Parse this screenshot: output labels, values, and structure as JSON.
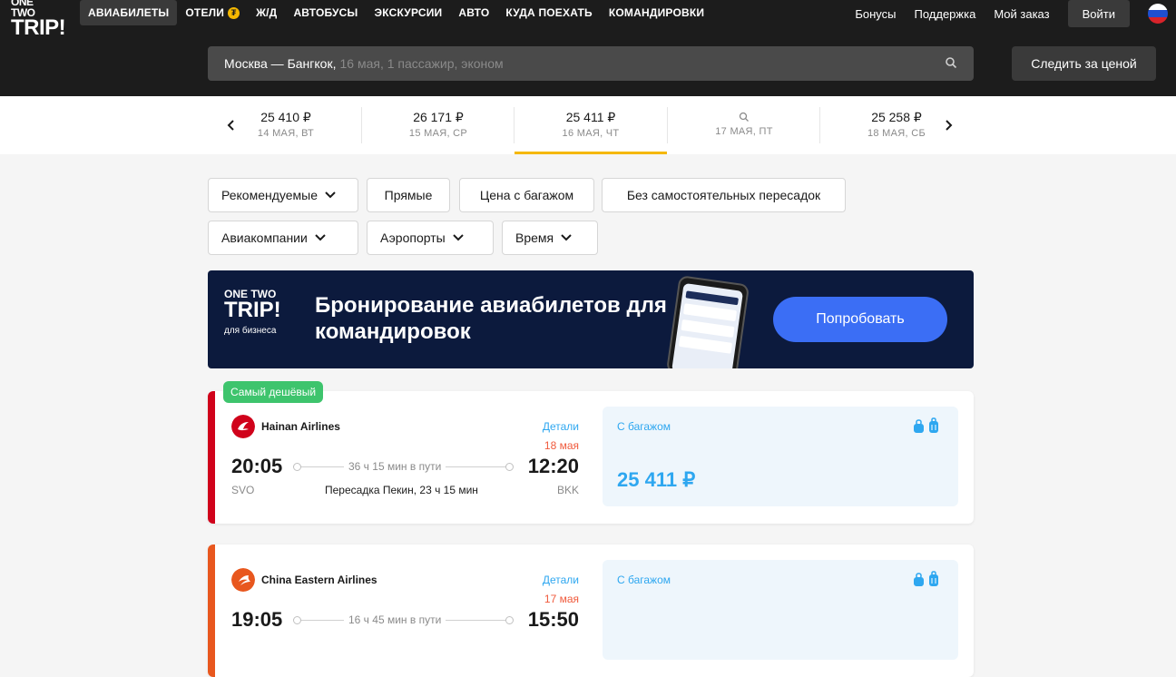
{
  "header": {
    "logo_line1": "ONE TWO",
    "logo_line2": "TRIP!",
    "nav": [
      {
        "label": "АВИАБИЛЕТЫ"
      },
      {
        "label": "ОТЕЛИ"
      },
      {
        "label": "Ж/Д"
      },
      {
        "label": "АВТОБУСЫ"
      },
      {
        "label": "ЭКСКУРСИИ"
      },
      {
        "label": "АВТО"
      },
      {
        "label": "КУДА ПОЕХАТЬ"
      },
      {
        "label": "КОМАНДИРОВКИ"
      }
    ],
    "links": {
      "bonuses": "Бонусы",
      "support": "Поддержка",
      "my_order": "Мой заказ",
      "login": "Войти"
    }
  },
  "search": {
    "route": "Москва — Бангкок,",
    "details": "16 мая, 1 пассажир, эконом",
    "track_label": "Следить за ценой"
  },
  "dates": [
    {
      "price": "25 410 ₽",
      "day": "14 МАЯ, ВТ"
    },
    {
      "price": "26 171 ₽",
      "day": "15 МАЯ, СР"
    },
    {
      "price": "25 411 ₽",
      "day": "16 МАЯ, ЧТ",
      "selected": true
    },
    {
      "price": "",
      "day": "17 МАЯ, ПТ"
    },
    {
      "price": "25 258 ₽",
      "day": "18 МАЯ, СБ"
    }
  ],
  "filters": {
    "recommended": "Рекомендуемые",
    "direct": "Прямые",
    "with_baggage": "Цена с багажом",
    "no_self_transfer": "Без самостоятельных пересадок",
    "airlines": "Авиакомпании",
    "airports": "Аэропорты",
    "time": "Время"
  },
  "banner": {
    "logo_line1": "ONE TWO",
    "logo_line2": "TRIP!",
    "logo_sub": "для бизнеса",
    "title": "Бронирование авиабилетов для командировок",
    "cta": "Попробовать"
  },
  "flights": [
    {
      "badge": "Самый дешёвый",
      "airline": "Hainan Airlines",
      "details": "Детали",
      "arrival_date": "18 мая",
      "dep_time": "20:05",
      "arr_time": "12:20",
      "duration": "36 ч 15 мин в пути",
      "from": "SVO",
      "to": "BKK",
      "transfer": "Пересадка Пекин, 23 ч 15 мин",
      "fare_label": "С багажом",
      "price": "25 411 ₽",
      "accent": "#d0021b"
    },
    {
      "airline": "China Eastern Airlines",
      "details": "Детали",
      "arrival_date": "17 мая",
      "dep_time": "19:05",
      "arr_time": "15:50",
      "duration": "16 ч 45 мин в пути",
      "fare_label": "С багажом",
      "accent": "#e8571e"
    }
  ],
  "colors": {
    "accent_yellow": "#f5b800",
    "link_blue": "#2ea7f0",
    "green_badge": "#3ec46d",
    "button_blue": "#3b6ef5"
  }
}
